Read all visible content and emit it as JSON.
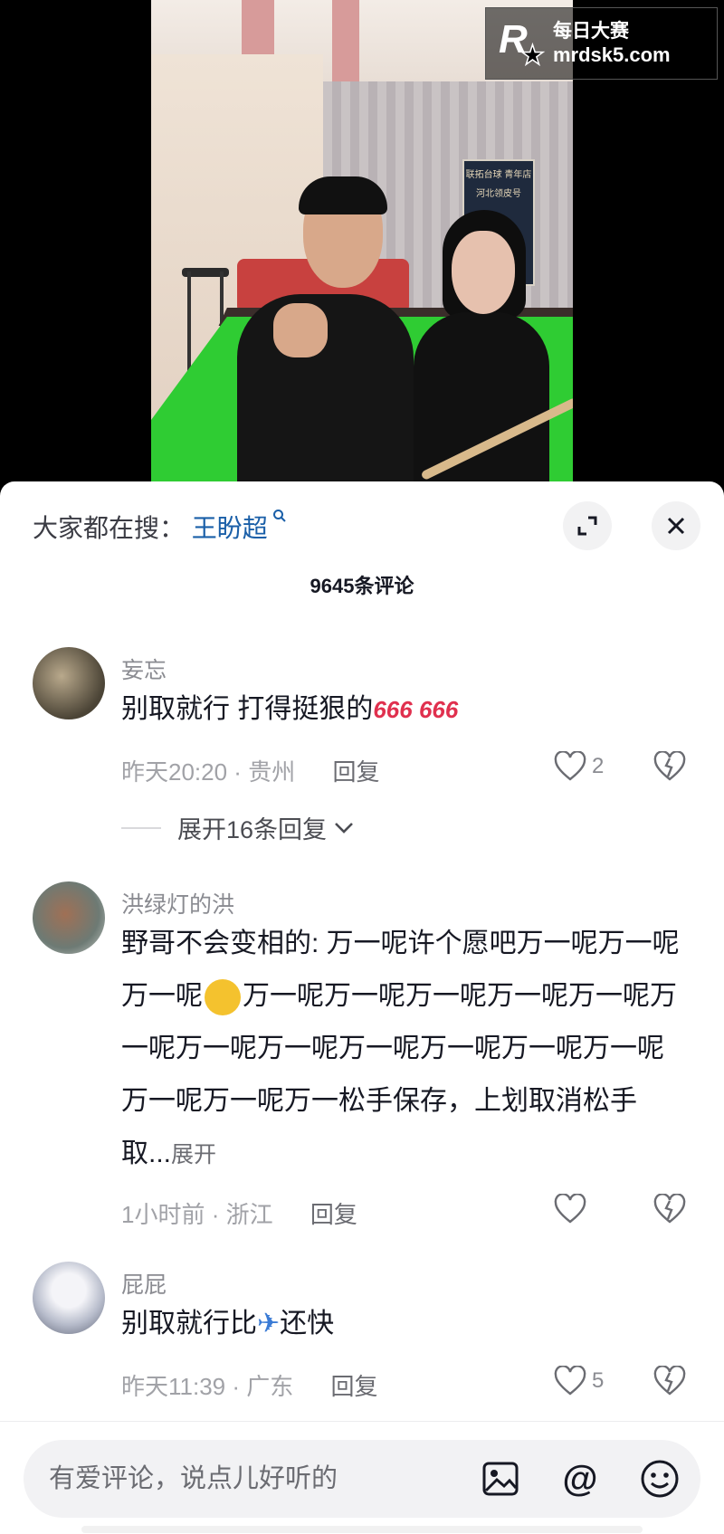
{
  "watermark": {
    "cn": "每日大赛",
    "url": "mrdsk5.com",
    "logo_letter": "R"
  },
  "video": {
    "banner_line1": "联拓台球 青年店",
    "banner_line2": "河北领皮号"
  },
  "panel": {
    "search_prefix": "大家都在搜：",
    "search_keyword": "王盼超",
    "comment_count": "9645条评论",
    "expand_icon": "expand-icon",
    "close_icon": "close-icon"
  },
  "comments": [
    {
      "username": "妄忘",
      "text": "别取就行 打得挺狠的",
      "emoji": "666 666",
      "time": "昨天20:20",
      "location": "贵州",
      "reply_label": "回复",
      "likes": "2",
      "expand_replies": "展开16条回复"
    },
    {
      "username": "洪绿灯的洪",
      "text": "野哥不会变相的: 万一呢许个愿吧万一呢万一呢万一呢",
      "text_2": "万一呢万一呢万一呢万一呢万一呢万一呢万一呢万一呢万一呢万一呢万一呢万一呢万一呢万一呢万一松手保存，上划取消松手取...",
      "more": "展开",
      "time": "1小时前",
      "location": "浙江",
      "reply_label": "回复",
      "likes": ""
    },
    {
      "username": "屁屁",
      "text": "别取就行比",
      "text_2": "还快",
      "time": "昨天11:39",
      "location": "广东",
      "reply_label": "回复",
      "likes": "5"
    }
  ],
  "composer": {
    "placeholder": "有爱评论，说点儿好听的",
    "icons": [
      "image-icon",
      "at-icon",
      "emoji-icon"
    ]
  },
  "colors": {
    "keyword_blue": "#1a5fa8",
    "muted_text": "#8a8b91",
    "table_green": "#2fcc33"
  }
}
